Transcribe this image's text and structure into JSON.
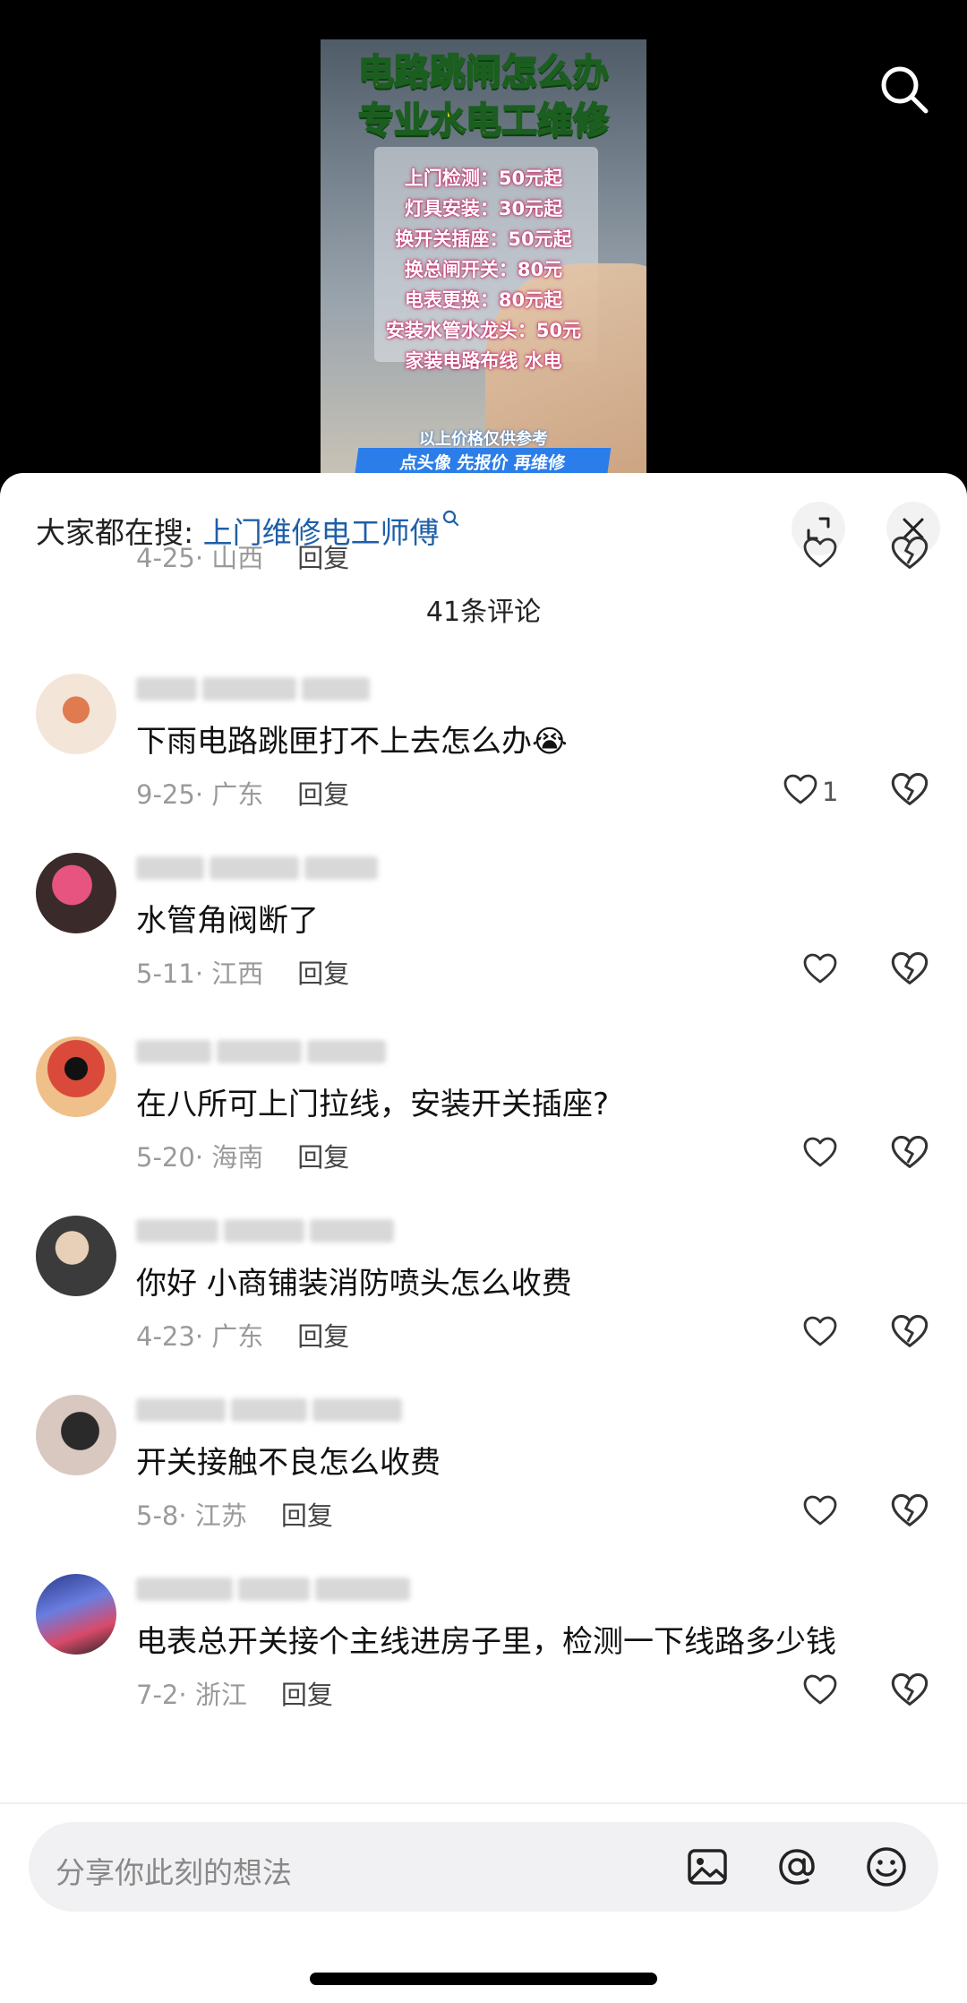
{
  "video": {
    "title_line1": "电路跳闸怎么办",
    "title_line2": "专业水电工维修",
    "price_lines": [
      "上门检测：50元起",
      "灯具安装：30元起",
      "换开关插座：50元起",
      "换总闸开关：80元",
      "电表更换：80元起",
      "安装水管水龙头：50元",
      "家装电路布线 水电"
    ],
    "note": "以上价格仅供参考",
    "banner": "点头像 先报价 再维修"
  },
  "sheet": {
    "search_prefix": "大家都在搜: ",
    "search_keyword": "上门维修电工师傅",
    "comment_count": "41条评论"
  },
  "comments": [
    {
      "text": "",
      "date": "4-25",
      "location": "山西",
      "reply": "回复",
      "likes": ""
    },
    {
      "text": "下雨电路跳匣打不上去怎么办😭",
      "date": "9-25",
      "location": "广东",
      "reply": "回复",
      "likes": "1"
    },
    {
      "text": "水管角阀断了",
      "date": "5-11",
      "location": "江西",
      "reply": "回复",
      "likes": ""
    },
    {
      "text": "在八所可上门拉线，安装开关插座?",
      "date": "5-20",
      "location": "海南",
      "reply": "回复",
      "likes": ""
    },
    {
      "text": "你好  小商铺装消防喷头怎么收费",
      "date": "4-23",
      "location": "广东",
      "reply": "回复",
      "likes": ""
    },
    {
      "text": "开关接触不良怎么收费",
      "date": "5-8",
      "location": "江苏",
      "reply": "回复",
      "likes": ""
    },
    {
      "text": "电表总开关接个主线进房子里，检测一下线路多少钱",
      "date": "7-2",
      "location": "浙江",
      "reply": "回复",
      "likes": ""
    }
  ],
  "input": {
    "placeholder": "分享你此刻的想法"
  },
  "icons": {
    "search": "search-icon",
    "expand": "expand-icon",
    "close": "close-icon",
    "like": "heart-icon",
    "dislike": "broken-heart-icon",
    "image": "image-icon",
    "mention": "at-icon",
    "emoji": "emoji-icon"
  },
  "colors": {
    "keyword": "#1f5fa8",
    "meta": "#9a9a9a"
  }
}
